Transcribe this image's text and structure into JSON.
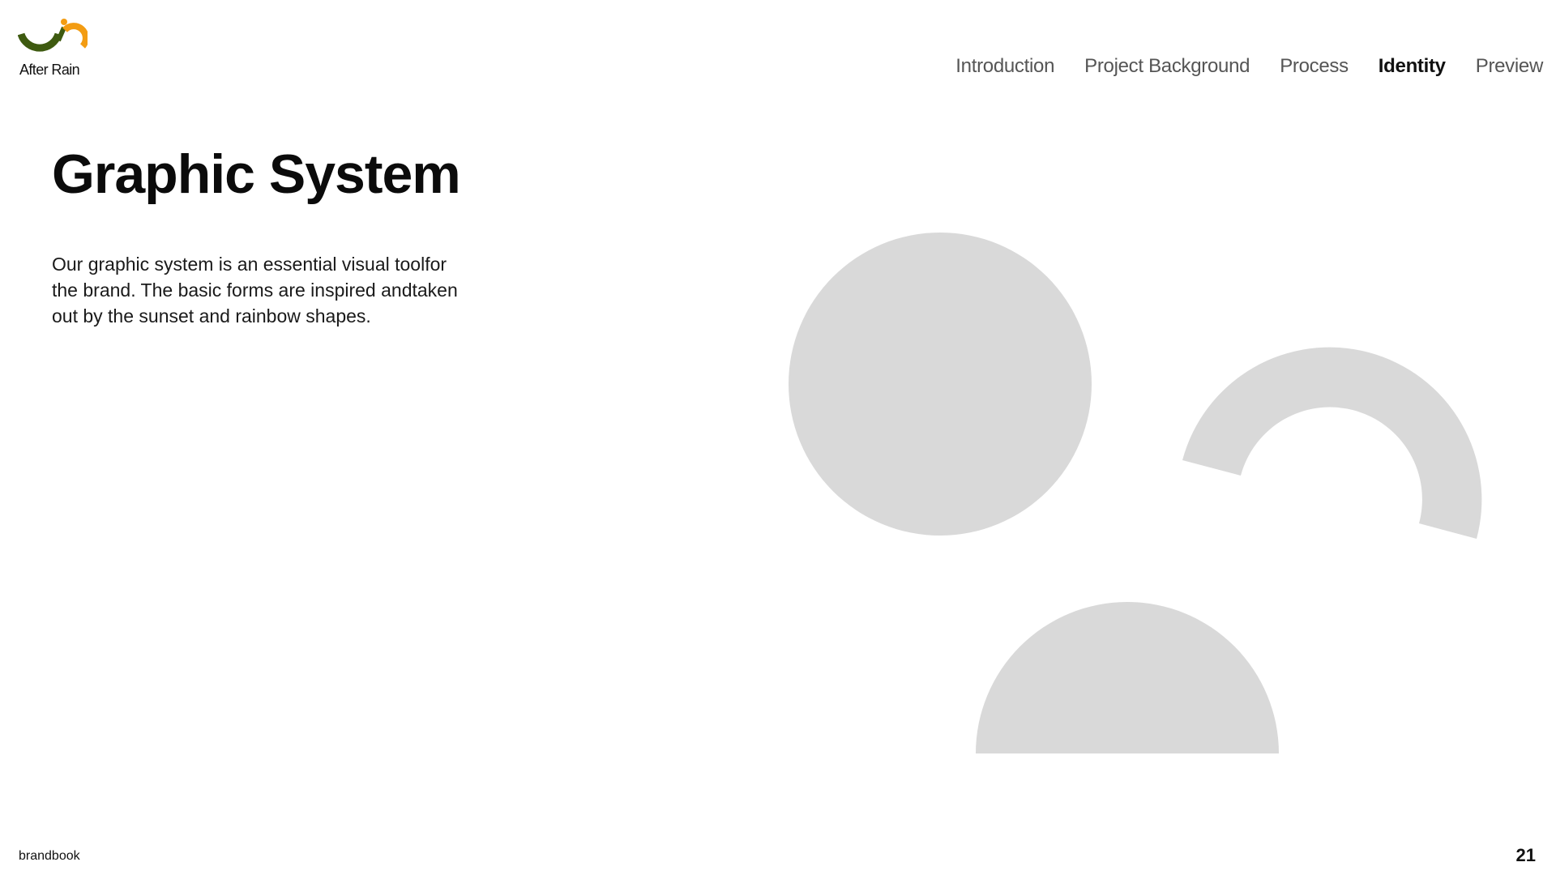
{
  "brand": {
    "name": "After Rain",
    "colors": {
      "green": "#3e5a10",
      "orange": "#f39c12",
      "shape_gray": "#d9d9d9"
    }
  },
  "nav": {
    "items": [
      {
        "label": "Introduction",
        "active": false
      },
      {
        "label": "Project Background",
        "active": false
      },
      {
        "label": "Process",
        "active": false
      },
      {
        "label": "Identity",
        "active": true
      },
      {
        "label": "Preview",
        "active": false
      }
    ]
  },
  "content": {
    "title": "Graphic System",
    "description_lines": [
      "Our graphic system is an essential visual toolfor",
      "the brand. The basic forms are inspired andtaken",
      "out by the sunset and rainbow shapes."
    ]
  },
  "shapes": [
    "circle",
    "rainbow-arc",
    "semicircle"
  ],
  "footer": {
    "label": "brandbook",
    "page_number": "21"
  }
}
